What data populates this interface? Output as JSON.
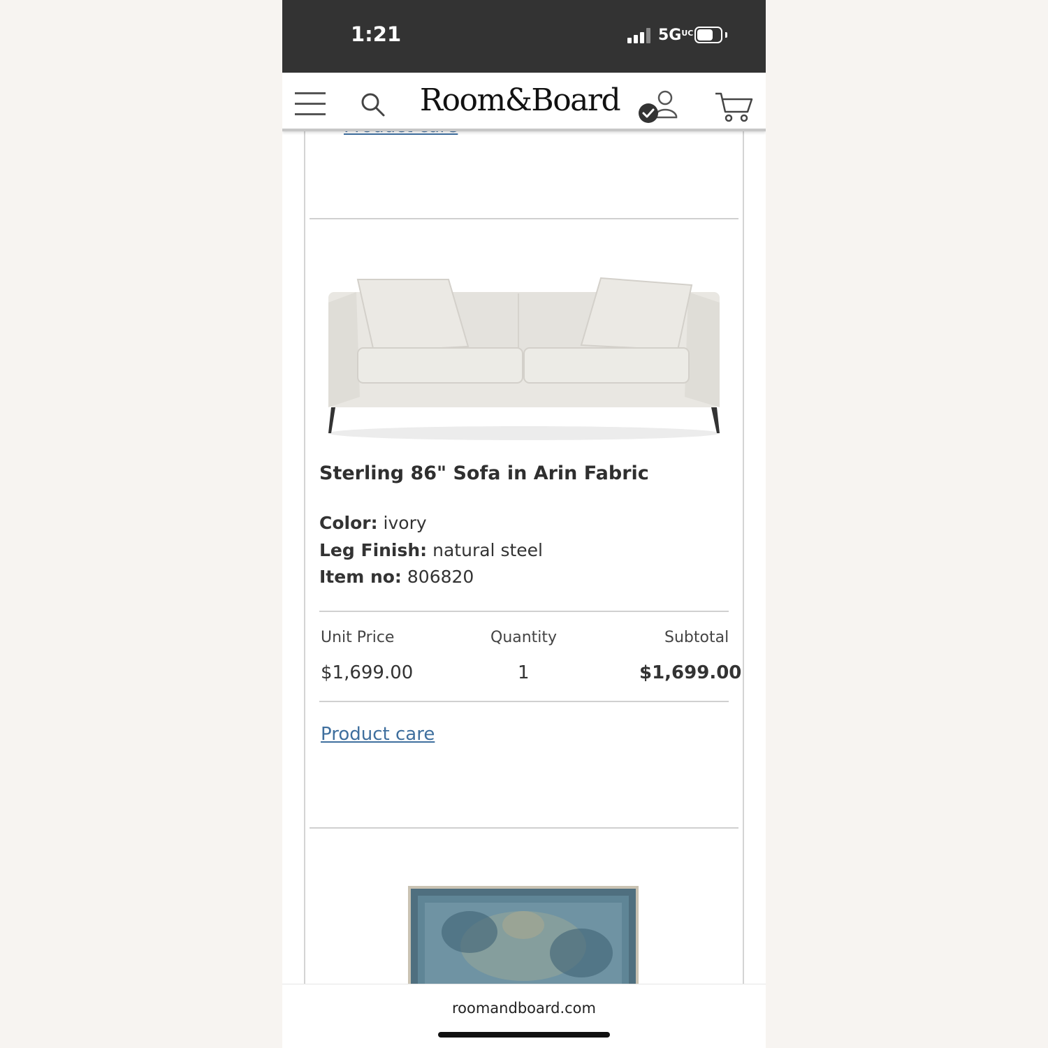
{
  "status_bar": {
    "time": "1:21",
    "network": "5G",
    "network_sup": "UC"
  },
  "header": {
    "logo": "Room&Board"
  },
  "items": {
    "previous_product_care": "Product care",
    "product": {
      "title": "Sterling 86\" Sofa in Arin Fabric",
      "color_label": "Color:",
      "color_value": "ivory",
      "leg_label": "Leg Finish:",
      "leg_value": "natural steel",
      "item_label": "Item no:",
      "item_value": "806820",
      "unit_price_label": "Unit Price",
      "quantity_label": "Quantity",
      "subtotal_label": "Subtotal",
      "unit_price": "$1,699.00",
      "quantity": "1",
      "subtotal": "$1,699.00",
      "product_care": "Product care"
    }
  },
  "browser": {
    "url": "roomandboard.com"
  },
  "colors": {
    "status_bar": "#333333",
    "link": "#3f6f9e",
    "page_bg": "#f7f4f1"
  }
}
